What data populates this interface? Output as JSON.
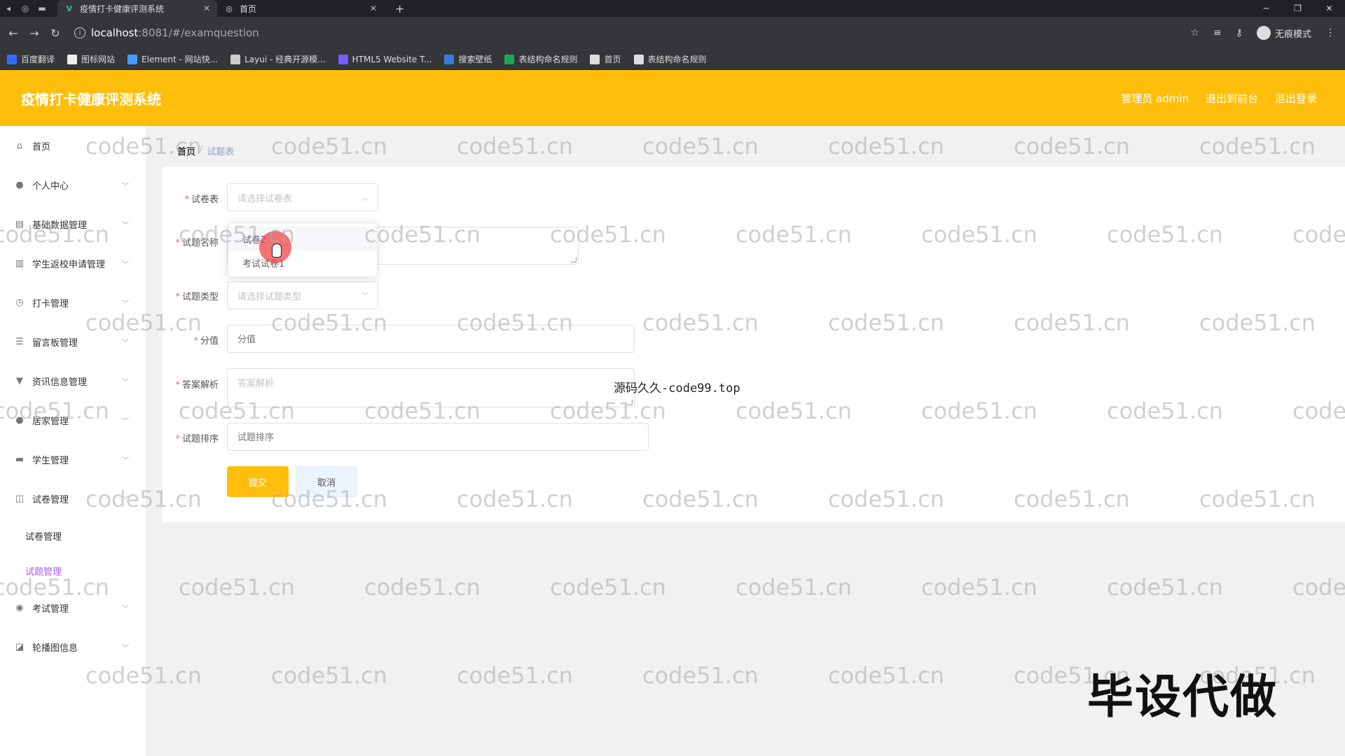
{
  "browser": {
    "tabs": [
      {
        "title": "疫情打卡健康评测系统",
        "active": true
      },
      {
        "title": "首页",
        "active": false
      }
    ],
    "url_host": "localhost",
    "url_path": ":8081/#/examquestion",
    "incognito_label": "无痕模式",
    "bookmarks": [
      {
        "label": "百度翻译",
        "color": "#2f6bff"
      },
      {
        "label": "图标网站",
        "color": "#eeeeee"
      },
      {
        "label": "Element - 网站快...",
        "color": "#409eff"
      },
      {
        "label": "Layui - 经典开源模...",
        "color": "#cccccc"
      },
      {
        "label": "HTML5 Website T...",
        "color": "#7b5cff"
      },
      {
        "label": "搜索壁纸",
        "color": "#3a7bd5"
      },
      {
        "label": "表结构命名规则",
        "color": "#22a55a"
      },
      {
        "label": "首页",
        "color": "#dddddd"
      },
      {
        "label": "表结构命名规则",
        "color": "#dddddd"
      }
    ]
  },
  "header": {
    "title": "疫情打卡健康评测系统",
    "admin": "管理员 admin",
    "to_front": "退出到前台",
    "logout": "退出登录",
    "accent": "#ffbe0b"
  },
  "sidebar": {
    "items": [
      {
        "label": "首页",
        "icon": "home-icon",
        "glyph": "⌂",
        "chevron": false
      },
      {
        "label": "个人中心",
        "icon": "user-icon",
        "glyph": "●",
        "chevron": true
      },
      {
        "label": "基础数据管理",
        "icon": "grid-icon",
        "glyph": "▤",
        "chevron": true
      },
      {
        "label": "学生返校申请管理",
        "icon": "bar-chart-icon",
        "glyph": "▥",
        "chevron": true
      },
      {
        "label": "打卡管理",
        "icon": "clock-icon",
        "glyph": "◷",
        "chevron": true
      },
      {
        "label": "留言板管理",
        "icon": "list-icon",
        "glyph": "☰",
        "chevron": true
      },
      {
        "label": "资讯信息管理",
        "icon": "chat-icon",
        "glyph": "▼",
        "chevron": true
      },
      {
        "label": "居家管理",
        "icon": "person-icon",
        "glyph": "●",
        "chevron": true
      },
      {
        "label": "学生管理",
        "icon": "briefcase-icon",
        "glyph": "▬",
        "chevron": true
      },
      {
        "label": "试卷管理",
        "icon": "crop-icon",
        "glyph": "◫",
        "chevron": true
      }
    ],
    "sub_items": [
      {
        "label": "试卷管理",
        "active": false
      },
      {
        "label": "试题管理",
        "active": true
      }
    ],
    "items_after": [
      {
        "label": "考试管理",
        "icon": "mic-icon",
        "glyph": "◉",
        "chevron": true
      },
      {
        "label": "轮播图信息",
        "icon": "image-icon",
        "glyph": "◪",
        "chevron": true
      }
    ]
  },
  "breadcrumb": {
    "home": "首页",
    "sep": "/",
    "current": "试题表"
  },
  "form": {
    "paper": {
      "label": "试卷表",
      "placeholder": "请选择试卷表"
    },
    "name": {
      "label": "试题名称"
    },
    "type": {
      "label": "试题类型",
      "placeholder": "请选择试题类型"
    },
    "score": {
      "label": "分值",
      "placeholder": "分值"
    },
    "analysis": {
      "label": "答案解析",
      "placeholder": "答案解析"
    },
    "order": {
      "label": "试题排序",
      "placeholder": "试题排序"
    },
    "submit": "提交",
    "cancel": "取消"
  },
  "dropdown": {
    "options": [
      "试卷2",
      "考试试卷1"
    ]
  },
  "watermark": "code51.cn",
  "overlay_note": "源码久久-code99.top",
  "overlay_big": "毕设代做"
}
